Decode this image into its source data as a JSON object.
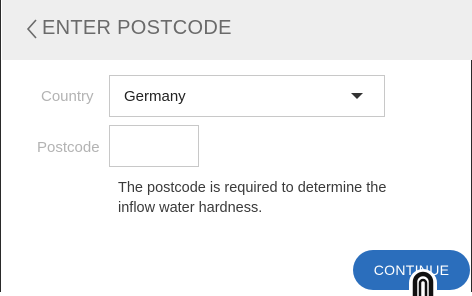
{
  "header": {
    "back_icon": "chevron-left-icon",
    "title": "ENTER POSTCODE"
  },
  "form": {
    "country": {
      "label": "Country",
      "selected_value": "Germany",
      "arrow_icon": "caret-down-icon"
    },
    "postcode": {
      "label": "Postcode",
      "value": "",
      "placeholder": ""
    },
    "hint": "The postcode is required to determine the inflow water hardness."
  },
  "actions": {
    "continue_label": "CONTINUE"
  },
  "colors": {
    "header_bg": "#eeeeee",
    "title": "#6a6a6a",
    "label": "#b3b3b3",
    "button": "#2b6ebc",
    "button_text": "#ffffff"
  },
  "overlay": {
    "pointer_icon": "touch-pointer-icon"
  }
}
